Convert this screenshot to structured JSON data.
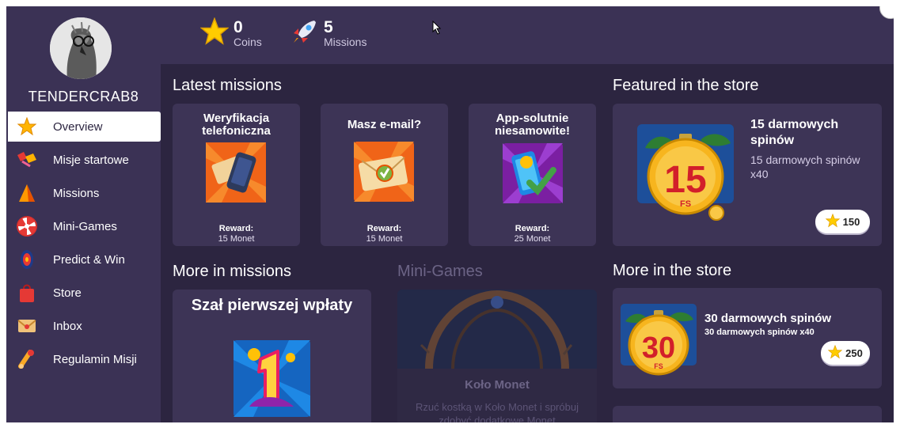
{
  "user": {
    "name": "TENDERCRAB8"
  },
  "nav": [
    {
      "label": "Overview",
      "icon": "star-icon",
      "active": true
    },
    {
      "label": "Misje startowe",
      "icon": "kite-icon"
    },
    {
      "label": "Missions",
      "icon": "cone-icon"
    },
    {
      "label": "Mini-Games",
      "icon": "wheel-icon"
    },
    {
      "label": "Predict & Win",
      "icon": "target-icon"
    },
    {
      "label": "Store",
      "icon": "bag-icon"
    },
    {
      "label": "Inbox",
      "icon": "envelope-icon"
    },
    {
      "label": "Regulamin Misji",
      "icon": "scroll-icon"
    }
  ],
  "stats": {
    "coins": {
      "value": "0",
      "label": "Coins",
      "icon": "star-icon"
    },
    "missions": {
      "value": "5",
      "label": "Missions",
      "icon": "rocket-icon"
    }
  },
  "latest": {
    "title": "Latest missions",
    "reward_label": "Reward:",
    "items": [
      {
        "title": "Weryfikacja telefoniczna",
        "reward": "15 Monet"
      },
      {
        "title": "Masz e-mail?",
        "reward": "15 Monet"
      },
      {
        "title": "App-solutnie niesamowite!",
        "reward": "25 Monet"
      }
    ]
  },
  "featured": {
    "title": "Featured in the store",
    "item": {
      "name": "15 darmowych spinów",
      "desc": "15 darmowych spinów x40",
      "price": "150",
      "badge": "15",
      "badge_sub": "FS"
    }
  },
  "more_missions": {
    "title": "More in missions",
    "item_title": "Szał pierwszej wpłaty"
  },
  "minigames": {
    "title": "Mini-Games",
    "item_title": "Koło Monet",
    "item_desc": "Rzuć kostką w Koło Monet i spróbuj zdobyć dodatkowe Monet"
  },
  "more_store": {
    "title": "More in the store",
    "item": {
      "name": "30 darmowych spinów",
      "desc": "30 darmowych spinów x40",
      "price": "250",
      "badge": "30",
      "badge_sub": "FS"
    }
  },
  "colors": {
    "bg": "#2c2540",
    "panel": "#3b3255",
    "card": "#3d3456",
    "accent": "#ffc400"
  }
}
